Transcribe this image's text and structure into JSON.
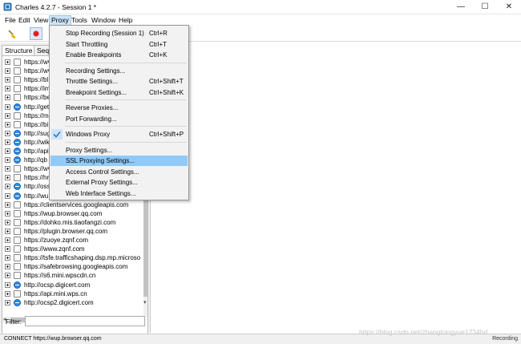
{
  "window": {
    "title": "Charles 4.2.7 - Session 1 *",
    "minimize": "—",
    "maximize": "☐",
    "close": "✕"
  },
  "menubar": [
    "File",
    "Edit",
    "View",
    "Proxy",
    "Tools",
    "Window",
    "Help"
  ],
  "tabs": [
    "Structure",
    "Sequ"
  ],
  "hosts": [
    {
      "label": "https://wv",
      "icon": "lock"
    },
    {
      "label": "https://wv",
      "icon": "lock"
    },
    {
      "label": "https://bl",
      "icon": "lock"
    },
    {
      "label": "https://im",
      "icon": "lock"
    },
    {
      "label": "https://be",
      "icon": "lock"
    },
    {
      "label": "http://get",
      "icon": "web"
    },
    {
      "label": "https://m",
      "icon": "lock"
    },
    {
      "label": "https://bi",
      "icon": "lock"
    },
    {
      "label": "http://sug",
      "icon": "web"
    },
    {
      "label": "http://wik",
      "icon": "web"
    },
    {
      "label": "http://api",
      "icon": "web"
    },
    {
      "label": "http://qb",
      "icon": "web"
    },
    {
      "label": "https://wv",
      "icon": "lock"
    },
    {
      "label": "https://hr",
      "icon": "lock"
    },
    {
      "label": "http://oss",
      "icon": "web"
    },
    {
      "label": "http://wu",
      "icon": "web"
    },
    {
      "label": "https://clientservices.googleapis.com",
      "icon": "lock"
    },
    {
      "label": "https://wup.browser.qq.com",
      "icon": "lock"
    },
    {
      "label": "https://dohko.mis.tiaofangzi.com",
      "icon": "lock"
    },
    {
      "label": "https://plugin.browser.qq.com",
      "icon": "lock"
    },
    {
      "label": "https://zuoye.zqnf.com",
      "icon": "lock"
    },
    {
      "label": "https://www.zqnf.com",
      "icon": "lock"
    },
    {
      "label": "https://tsfe.trafficshaping.dsp.mp.microso",
      "icon": "lock"
    },
    {
      "label": "https://safebrowsing.googleapis.com",
      "icon": "lock"
    },
    {
      "label": "https://s6.mini.wpscdn.cn",
      "icon": "lock"
    },
    {
      "label": "http://ocsp.digicert.com",
      "icon": "web"
    },
    {
      "label": "https://api.mini.wps.cn",
      "icon": "lock"
    },
    {
      "label": "http://ocsp2.digicert.com",
      "icon": "web"
    }
  ],
  "filter": {
    "label": "Filter:",
    "value": ""
  },
  "proxy_menu": {
    "items": [
      {
        "label": "Stop Recording (Session 1)",
        "shortcut": "Ctrl+R"
      },
      {
        "label": "Start Throttling",
        "shortcut": "Ctrl+T"
      },
      {
        "label": "Enable Breakpoints",
        "shortcut": "Ctrl+K"
      },
      {
        "label": "Recording Settings...",
        "shortcut": ""
      },
      {
        "label": "Throttle Settings...",
        "shortcut": "Ctrl+Shift+T"
      },
      {
        "label": "Breakpoint Settings...",
        "shortcut": "Ctrl+Shift+K"
      },
      {
        "label": "Reverse Proxies...",
        "shortcut": ""
      },
      {
        "label": "Port Forwarding...",
        "shortcut": ""
      },
      {
        "label": "Windows Proxy",
        "shortcut": "Ctrl+Shift+P",
        "checked": true
      },
      {
        "label": "Proxy Settings...",
        "shortcut": ""
      },
      {
        "label": "SSL Proxying Settings...",
        "shortcut": "",
        "highlighted": true
      },
      {
        "label": "Access Control Settings...",
        "shortcut": ""
      },
      {
        "label": "External Proxy Settings...",
        "shortcut": ""
      },
      {
        "label": "Web Interface Settings...",
        "shortcut": ""
      }
    ]
  },
  "status": {
    "left": "CONNECT https://wup.browser.qq.com",
    "right": "Recording"
  },
  "watermark": "https://blog.csdn.net/zhangtongyue1234hd",
  "colors": {
    "menu_highlight": "#91c9f7",
    "record_button": "#e02020",
    "web_icon": "#2f8de4"
  }
}
